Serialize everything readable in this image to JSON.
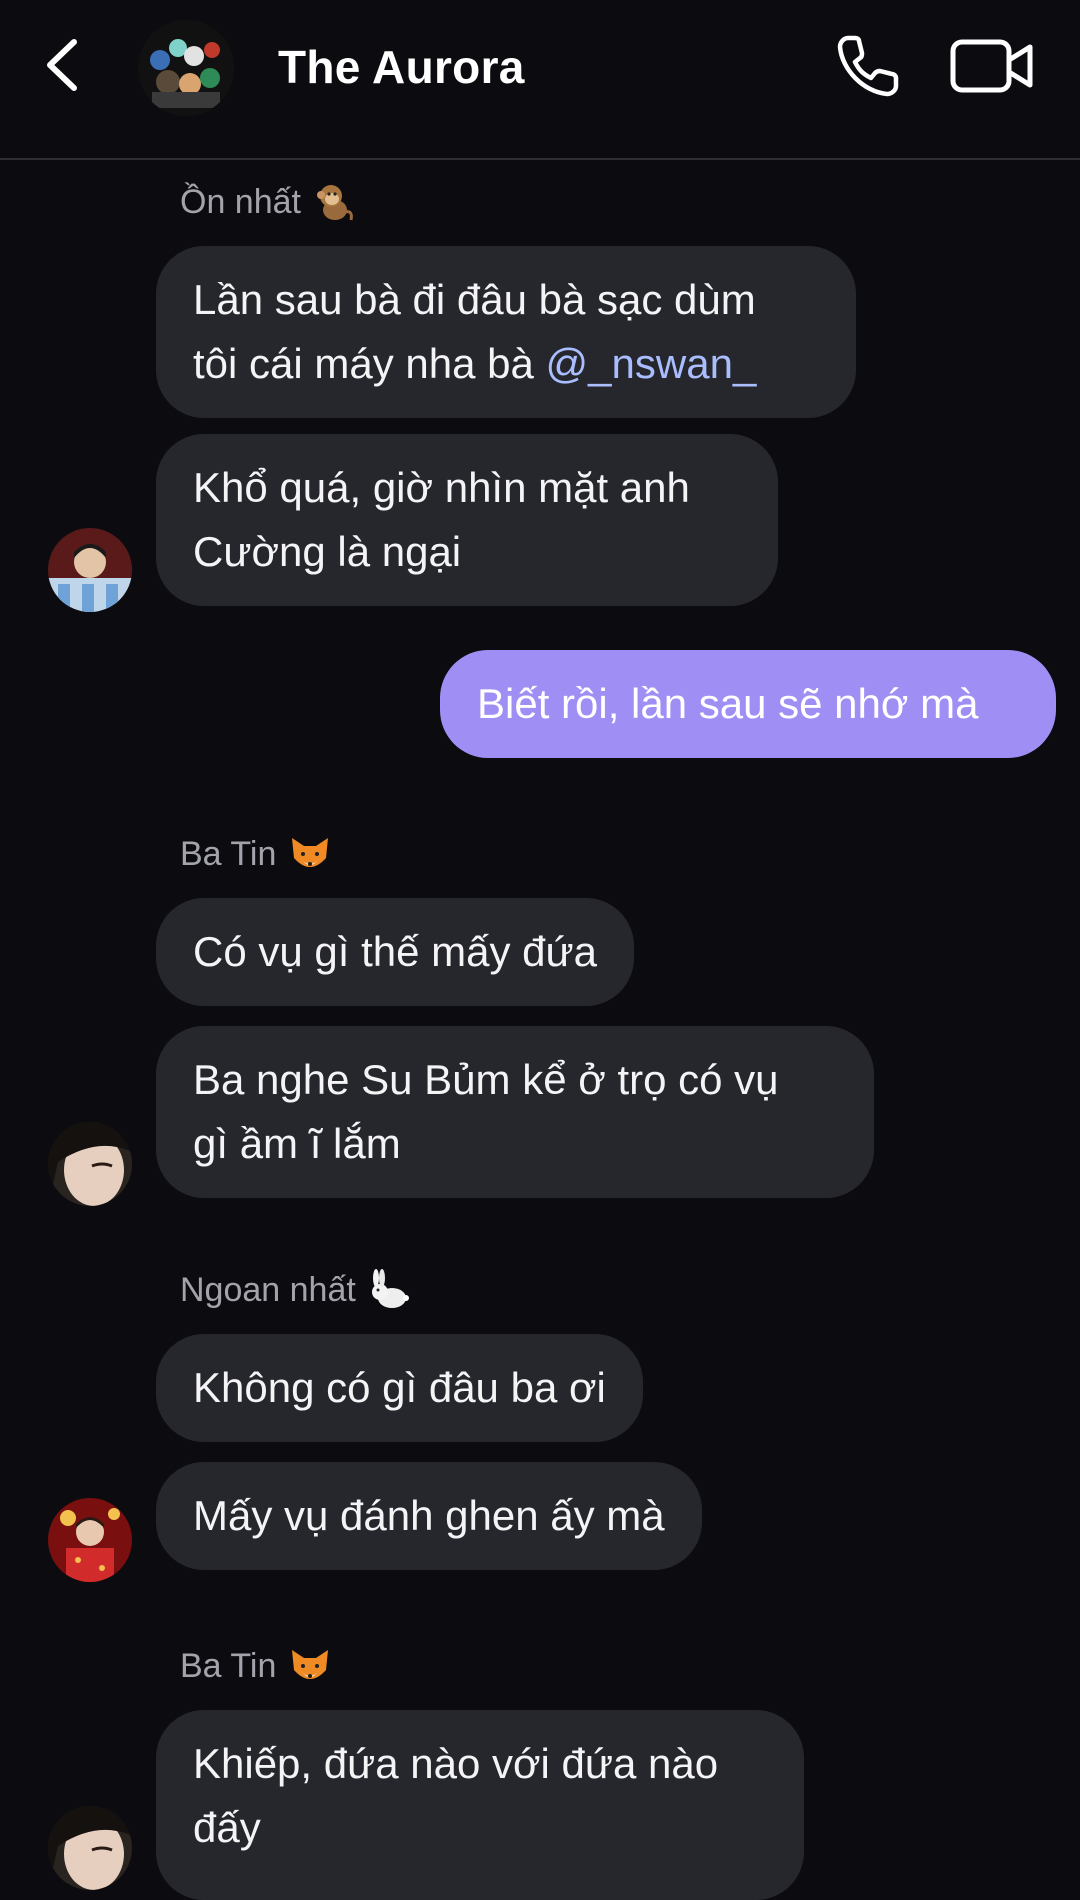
{
  "header": {
    "title": "The Aurora"
  },
  "messages": [
    {
      "sender": "Ồn nhất",
      "sender_emoji": "monkey",
      "bubbles": [
        {
          "text": "Lần sau bà đi đâu bà sạc dùm",
          "text2": "tôi cái máy nha bà",
          "mention": "@_nswan_"
        },
        {
          "line1": "Khổ quá, giờ nhìn mặt anh",
          "line2": "Cường là ngại"
        }
      ]
    },
    {
      "sender": "me",
      "bubbles": [
        {
          "text": "Biết rồi, lần sau sẽ nhớ mà"
        }
      ]
    },
    {
      "sender": "Ba Tin",
      "sender_emoji": "fox",
      "bubbles": [
        {
          "text": "Có vụ gì thế mấy đứa"
        },
        {
          "line1": "Ba nghe Su Bủm kể ở trọ có vụ",
          "line2": "gì ầm ĩ lắm"
        }
      ]
    },
    {
      "sender": "Ngoan nhất",
      "sender_emoji": "rabbit",
      "bubbles": [
        {
          "text": "Không có gì đâu ba ơi"
        },
        {
          "text": "Mấy vụ đánh ghen ấy mà"
        }
      ]
    },
    {
      "sender": "Ba Tin",
      "sender_emoji": "fox",
      "bubbles": [
        {
          "line1": "Khiếp, đứa nào với đứa nào",
          "line2": "đấy"
        }
      ]
    }
  ],
  "colors": {
    "background": "#0c0c10",
    "incoming_bubble": "#26272c",
    "outgoing_bubble": "#9f8ff4",
    "mention": "#a9bdff",
    "sender_name": "#a3a3ab"
  }
}
